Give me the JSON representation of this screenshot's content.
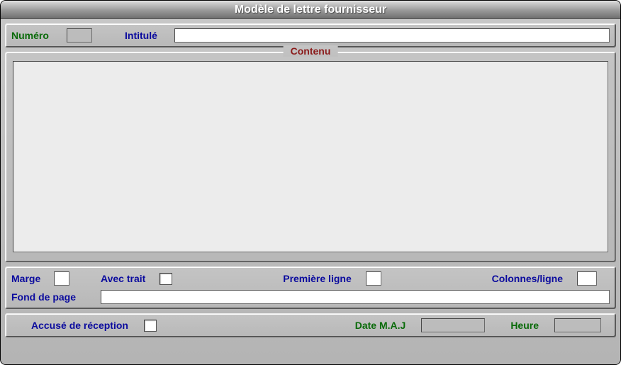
{
  "window": {
    "title": "Modèle de lettre fournisseur"
  },
  "header": {
    "numero_label": "Numéro",
    "numero_value": "",
    "intitule_label": "Intitulé",
    "intitule_value": ""
  },
  "content": {
    "legend": "Contenu",
    "text": ""
  },
  "options": {
    "marge_label": "Marge",
    "marge_value": "",
    "avec_trait_label": "Avec trait",
    "avec_trait_checked": false,
    "premiere_ligne_label": "Première ligne",
    "premiere_ligne_value": "",
    "colonnes_ligne_label": "Colonnes/ligne",
    "colonnes_ligne_value": "",
    "fond_de_page_label": "Fond de page",
    "fond_de_page_value": ""
  },
  "footer": {
    "accuse_label": "Accusé de réception",
    "accuse_checked": false,
    "date_maj_label": "Date M.A.J",
    "date_maj_value": "",
    "heure_label": "Heure",
    "heure_value": ""
  }
}
